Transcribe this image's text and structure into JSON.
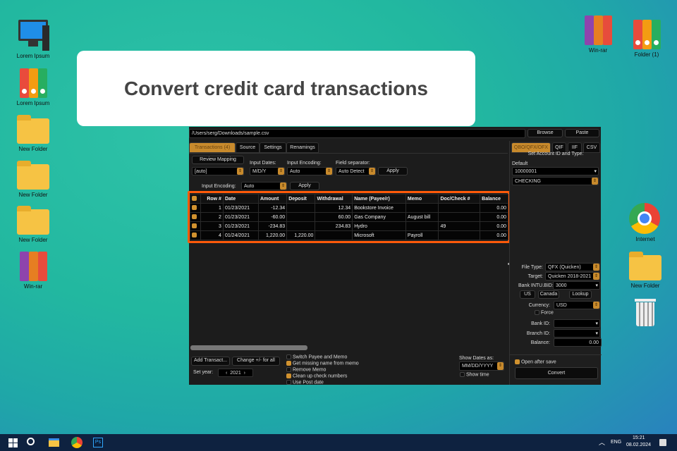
{
  "desktop": {
    "left_icons": [
      "Lorem Ipsum",
      "Lorem Ipsum",
      "New Folder",
      "New Folder",
      "New Folder",
      "Win-rar"
    ],
    "right_icons": [
      "Win-rar",
      "Folder (1)",
      "Internet",
      "New Folder"
    ]
  },
  "banner": {
    "title": "Convert credit card transactions"
  },
  "app": {
    "path": "/Users/serg/Downloads/sample.csv",
    "browse": "Browse",
    "paste": "Paste",
    "tabs": [
      "Transactions (4)",
      "Source",
      "Settings",
      "Renamings"
    ],
    "review_mapping": "Review Mapping",
    "mapping_value": "[auto]",
    "input_dates_label": "Input Dates:",
    "input_dates_value": "M/D/Y",
    "input_encoding_label": "Input Encoding:",
    "input_encoding_value": "Auto",
    "field_sep_label": "Field separator:",
    "field_sep_value": "Auto Detect",
    "apply": "Apply",
    "input_encoding2_label": "Input Encoding:",
    "input_encoding2_value": "Auto",
    "apply2": "Apply",
    "columns": [
      "Row #",
      "Date",
      "Amount",
      "Deposit",
      "Withdrawal",
      "Name (Payee/r)",
      "Memo",
      "Doc/Check #",
      "Balance"
    ],
    "rows": [
      {
        "n": "1",
        "date": "01/23/2021",
        "amount": "-12.34",
        "deposit": "",
        "withdrawal": "12.34",
        "name": "Bookstore Invoice",
        "memo": "",
        "doc": "",
        "balance": "0.00"
      },
      {
        "n": "2",
        "date": "01/23/2021",
        "amount": "-60.00",
        "deposit": "",
        "withdrawal": "60.00",
        "name": "Gas Company",
        "memo": "August bill",
        "doc": "",
        "balance": "0.00"
      },
      {
        "n": "3",
        "date": "01/23/2021",
        "amount": "-234.83",
        "deposit": "",
        "withdrawal": "234.83",
        "name": "Hydro",
        "memo": "",
        "doc": "49",
        "balance": "0.00"
      },
      {
        "n": "4",
        "date": "01/24/2021",
        "amount": "1,220.00",
        "deposit": "1,220.00",
        "withdrawal": "",
        "name": "Microsoft",
        "memo": "Payroll",
        "doc": "",
        "balance": "0.00"
      }
    ],
    "add_transact": "Add Transact...",
    "change_sign": "Change +/- for all",
    "set_year_label": "Set year:",
    "year": "2021",
    "options": [
      {
        "label": "Switch Payee and Memo",
        "checked": false
      },
      {
        "label": "Get missing name from memo",
        "checked": true
      },
      {
        "label": "Remove Memo",
        "checked": false
      },
      {
        "label": "Clean up check numbers",
        "checked": true
      },
      {
        "label": "Use Post date",
        "checked": false
      }
    ],
    "show_dates_label": "Show Dates as:",
    "show_dates_value": "MM/DD/YYYY",
    "show_time": "Show time",
    "right": {
      "tabs": [
        "QBO/QFX/OFX",
        "QIF",
        "IIF",
        "CSV"
      ],
      "set_account": "Set Account ID and Type:",
      "default_label": "Default",
      "account_id": "10000001",
      "account_type": "CHECKING",
      "file_type_label": "File Type:",
      "file_type": "QFX (Quicken)",
      "target_label": "Target:",
      "target": "Quicken 2018-2021",
      "bank_label": "Bank INTU.BID:",
      "bank_value": "3000",
      "us": "US",
      "canada": "Canada",
      "lookup": "Lookup",
      "currency_label": "Currency:",
      "currency": "USD",
      "force": "Force",
      "bank_id_label": "Bank ID:",
      "branch_id_label": "Branch ID:",
      "balance_label": "Balance:",
      "balance": "0.00",
      "open_after_save": "Open after save",
      "convert": "Convert"
    }
  },
  "taskbar": {
    "lang": "ENG",
    "time": "15:21",
    "date": "08.02.2024"
  }
}
